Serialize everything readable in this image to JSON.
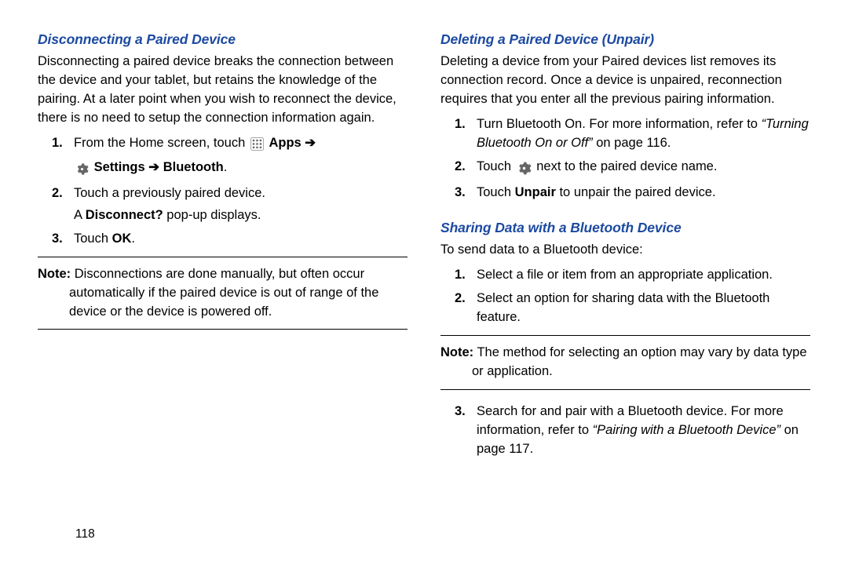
{
  "page_number": "118",
  "left": {
    "heading": "Disconnecting a Paired Device",
    "intro": "Disconnecting a paired device breaks the connection between the device and your tablet, but retains the knowledge of the pairing. At a later point when you wish to reconnect the device, there is no need to setup the connection information again.",
    "steps": {
      "s1_num": "1.",
      "s1_a": "From the Home screen, touch",
      "s1_apps": "Apps",
      "s1_arrow1": "➔",
      "s1_settings": "Settings",
      "s1_arrow2": "➔",
      "s1_bt": "Bluetooth",
      "s1_dot": ".",
      "s2_num": "2.",
      "s2_a": "Touch a previously paired device.",
      "s2_b_a": "A ",
      "s2_b_bold": "Disconnect?",
      "s2_b_c": " pop-up displays.",
      "s3_num": "3.",
      "s3_a": "Touch ",
      "s3_ok": "OK",
      "s3_dot": "."
    },
    "note": {
      "lead": "Note:",
      "body": "Disconnections are done manually, but often occur automatically if the paired device is out of range of the device or the device is powered off."
    }
  },
  "right": {
    "heading1": "Deleting a Paired Device (Unpair)",
    "intro1": "Deleting a device from your Paired devices list removes its connection record. Once a device is unpaired, reconnection requires that you enter all the previous pairing information.",
    "steps1": {
      "s1_num": "1.",
      "s1_a": "Turn Bluetooth On. For more information, refer to",
      "s1_ref": "“Turning Bluetooth On or Off”",
      "s1_pg": "on page 116.",
      "s2_num": "2.",
      "s2_a": "Touch",
      "s2_b": "next to the paired device name.",
      "s3_num": "3.",
      "s3_a": "Touch ",
      "s3_bold": "Unpair",
      "s3_b": " to unpair the paired device."
    },
    "heading2": "Sharing Data with a Bluetooth Device",
    "intro2": "To send data to a Bluetooth device:",
    "steps2a": {
      "s1_num": "1.",
      "s1": "Select a file or item from an appropriate application.",
      "s2_num": "2.",
      "s2": "Select an option for sharing data with the Bluetooth feature."
    },
    "note": {
      "lead": "Note:",
      "body": "The method for selecting an option may vary by data type or application."
    },
    "steps2b": {
      "s3_num": "3.",
      "s3_a": "Search for and pair with a Bluetooth device. For more information, refer to ",
      "s3_ref": "“Pairing with a Bluetooth Device”",
      "s3_pg": "on page 117."
    }
  }
}
